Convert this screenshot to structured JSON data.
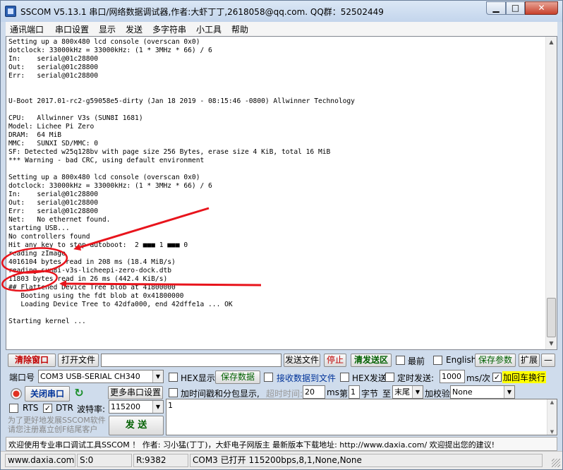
{
  "window": {
    "title": "SSCOM V5.13.1 串口/网络数据调试器,作者:大虾丁丁,2618058@qq.com. QQ群：52502449",
    "min_label": "▁",
    "max_label": "□",
    "close_label": "✕"
  },
  "menu": [
    "通讯端口",
    "串口设置",
    "显示",
    "发送",
    "多字符串",
    "小工具",
    "帮助"
  ],
  "console": {
    "lines": [
      "Setting up a 800x480 lcd console (overscan 0x0)",
      "dotclock: 33000kHz = 33000kHz: (1 * 3MHz * 66) / 6",
      "In:    serial@01c28800",
      "Out:   serial@01c28800",
      "Err:   serial@01c28800",
      "",
      "",
      "U-Boot 2017.01-rc2-g59058e5-dirty (Jan 18 2019 - 08:15:46 -0800) Allwinner Technology",
      "",
      "CPU:   Allwinner V3s (SUN8I 1681)",
      "Model: Lichee Pi Zero",
      "DRAM:  64 MiB",
      "MMC:   SUNXI SD/MMC: 0",
      "SF: Detected w25q128bv with page size 256 Bytes, erase size 4 KiB, total 16 MiB",
      "*** Warning - bad CRC, using default environment",
      "",
      "Setting up a 800x480 lcd console (overscan 0x0)",
      "dotclock: 33000kHz = 33000kHz: (1 * 3MHz * 66) / 6",
      "In:    serial@01c28800",
      "Out:   serial@01c28800",
      "Err:   serial@01c28800",
      "Net:   No ethernet found.",
      "starting USB...",
      "No controllers found",
      "Hit any key to stop autoboot:  2 ■■■ 1 ■■■ 0",
      "reading zImage",
      "4016104 bytes read in 208 ms (18.4 MiB/s)",
      "reading sun8i-v3s-licheepi-zero-dock.dtb",
      "11803 bytes read in 26 ms (442.4 KiB/s)",
      "## Flattened Device Tree blob at 41800000",
      "   Booting using the fdt blob at 0x41800000",
      "   Loading Device Tree to 42dfa000, end 42dffe1a ... OK",
      "",
      "Starting kernel ..."
    ]
  },
  "toolbar1": {
    "clear_window": "清除窗口",
    "open_file": "打开文件",
    "send_file": "发送文件",
    "stop": "停止",
    "clear_send": "清发送区",
    "last": "最前",
    "english": "English",
    "save_params": "保存参数",
    "expand": "扩展",
    "collapse": "—"
  },
  "port": {
    "label": "端口号",
    "value": "COM3 USB-SERIAL CH340",
    "close_port": "关闭串口",
    "more_settings": "更多串口设置",
    "rts": "RTS",
    "dtr": "DTR",
    "baud_label": "波特率:",
    "baud_value": "115200"
  },
  "options": {
    "hex_display": "HEX显示",
    "save_data": "保存数据",
    "recv_to_file": "接收数据到文件",
    "hex_send": "HEX发送",
    "timed_send": "定时发送:",
    "interval": "1000",
    "interval_unit": "ms/次",
    "add_crlf": "加回车换行",
    "add_timestamp": "加时间戳和分包显示,",
    "timeout_label": "超时时间:",
    "timeout_value": "20",
    "ms": "ms",
    "byte_label": "第",
    "byte_value": "1",
    "byte_unit": "字节",
    "to": "至",
    "end_value": "末尾",
    "checksum_label": "加校验",
    "checksum_value": "None"
  },
  "send": {
    "text": "1",
    "send_button": "发 送"
  },
  "promo": "为了更好地发展SSCOM软件\n请您注册嘉立创F结尾客户",
  "adbar": "欢迎使用专业串口调试工具SSCOM ！  作者: 习小猛(丁丁)，大虾电子网版主  最新版本下载地址:  http://www.daxia.com/  欢迎提出您的建议!",
  "status": {
    "site": "www.daxia.com",
    "s": "S:0",
    "r": "R:9382",
    "port_status": "COM3 已打开  115200bps,8,1,None,None"
  },
  "colors": {
    "annotation": "#e8141c",
    "window_frame": "#cfdcec"
  }
}
